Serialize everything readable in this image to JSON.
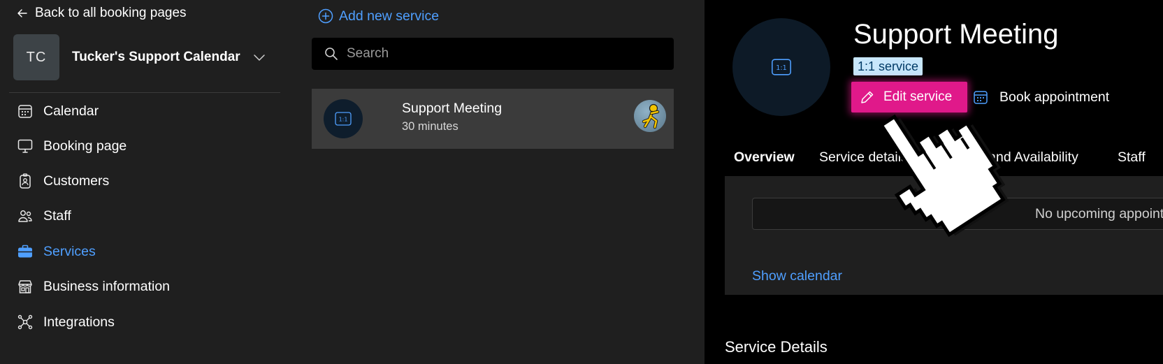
{
  "sidebar": {
    "back_label": "Back to all booking pages",
    "account": {
      "initials": "TC",
      "name": "Tucker's Support Calendar"
    },
    "items": [
      {
        "label": "Calendar",
        "icon": "calendar-icon",
        "active": false
      },
      {
        "label": "Booking page",
        "icon": "monitor-icon",
        "active": false
      },
      {
        "label": "Customers",
        "icon": "id-badge-icon",
        "active": false
      },
      {
        "label": "Staff",
        "icon": "people-icon",
        "active": false
      },
      {
        "label": "Services",
        "icon": "briefcase-icon",
        "active": true
      },
      {
        "label": "Business information",
        "icon": "storefront-icon",
        "active": false
      },
      {
        "label": "Integrations",
        "icon": "network-icon",
        "active": false
      }
    ]
  },
  "services_list": {
    "add_label": "Add new service",
    "search": {
      "placeholder": "Search",
      "value": ""
    },
    "items": [
      {
        "title": "Support Meeting",
        "duration": "30 minutes",
        "icon": "one-on-one-icon"
      }
    ]
  },
  "detail": {
    "title": "Support Meeting",
    "badge": "1:1 service",
    "edit_label": "Edit service",
    "book_label": "Book appointment",
    "tabs": [
      {
        "label": "Overview",
        "active": true
      },
      {
        "label": "Service details",
        "active": false
      },
      {
        "label": "Staff and Availability",
        "active": false
      },
      {
        "label": "Staff",
        "active": false
      }
    ],
    "appointments_empty": "No upcoming appointments",
    "show_calendar_label": "Show calendar",
    "section_heading": "Service Details"
  },
  "colors": {
    "accent": "#4f9fff",
    "highlight": "#e0198a",
    "badge_bg": "#c7e6fb",
    "panel_bg": "#000000",
    "sidebar_bg": "#1f1f1f"
  }
}
